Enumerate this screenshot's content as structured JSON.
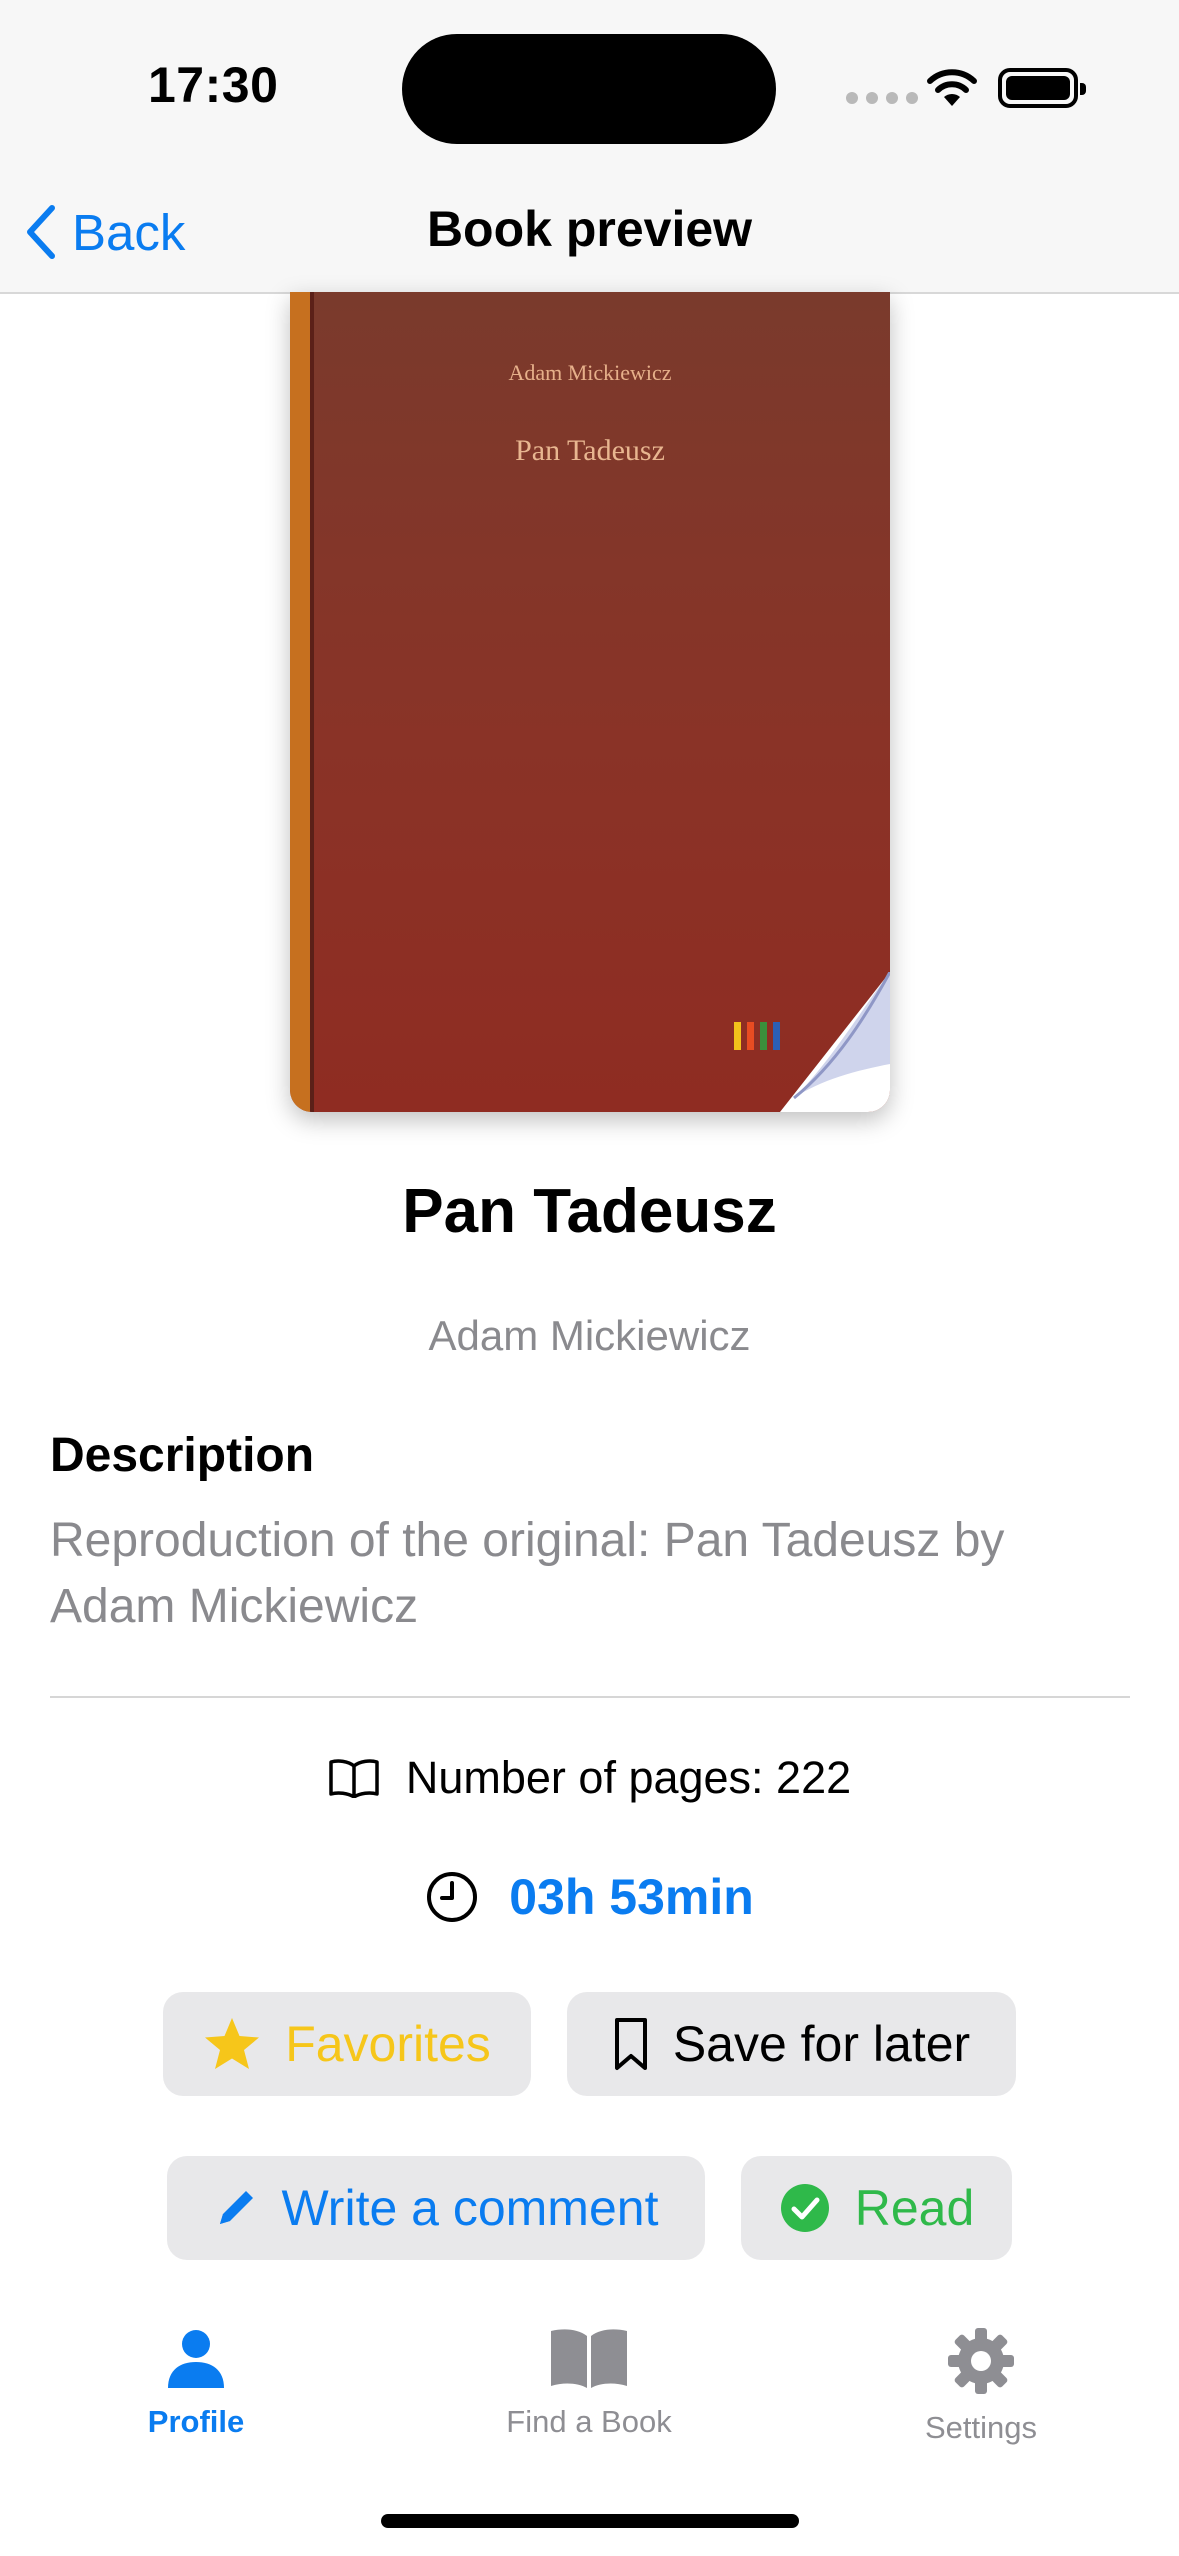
{
  "status_bar": {
    "time": "17:30"
  },
  "nav": {
    "back_label": "Back",
    "title": "Book preview"
  },
  "cover": {
    "author": "Adam Mickiewicz",
    "title": "Pan Tadeusz"
  },
  "book": {
    "title": "Pan Tadeusz",
    "author": "Adam Mickiewicz",
    "description_heading": "Description",
    "description": "Reproduction of the original: Pan Tadeusz by Adam Mickiewicz",
    "pages_text": "Number of pages: 222",
    "duration": "03h 53min"
  },
  "actions": {
    "favorites": "Favorites",
    "save_later": "Save for later",
    "write_comment": "Write a comment",
    "read": "Read"
  },
  "tabs": [
    {
      "label": "Profile",
      "icon": "person-icon",
      "active": true
    },
    {
      "label": "Find a Book",
      "icon": "book-icon",
      "active": false
    },
    {
      "label": "Settings",
      "icon": "gear-icon",
      "active": false
    }
  ],
  "colors": {
    "accent": "#0a7cf0",
    "favorite": "#f6c61a",
    "read": "#2fb94a",
    "secondary_text": "#8a8a8e"
  }
}
